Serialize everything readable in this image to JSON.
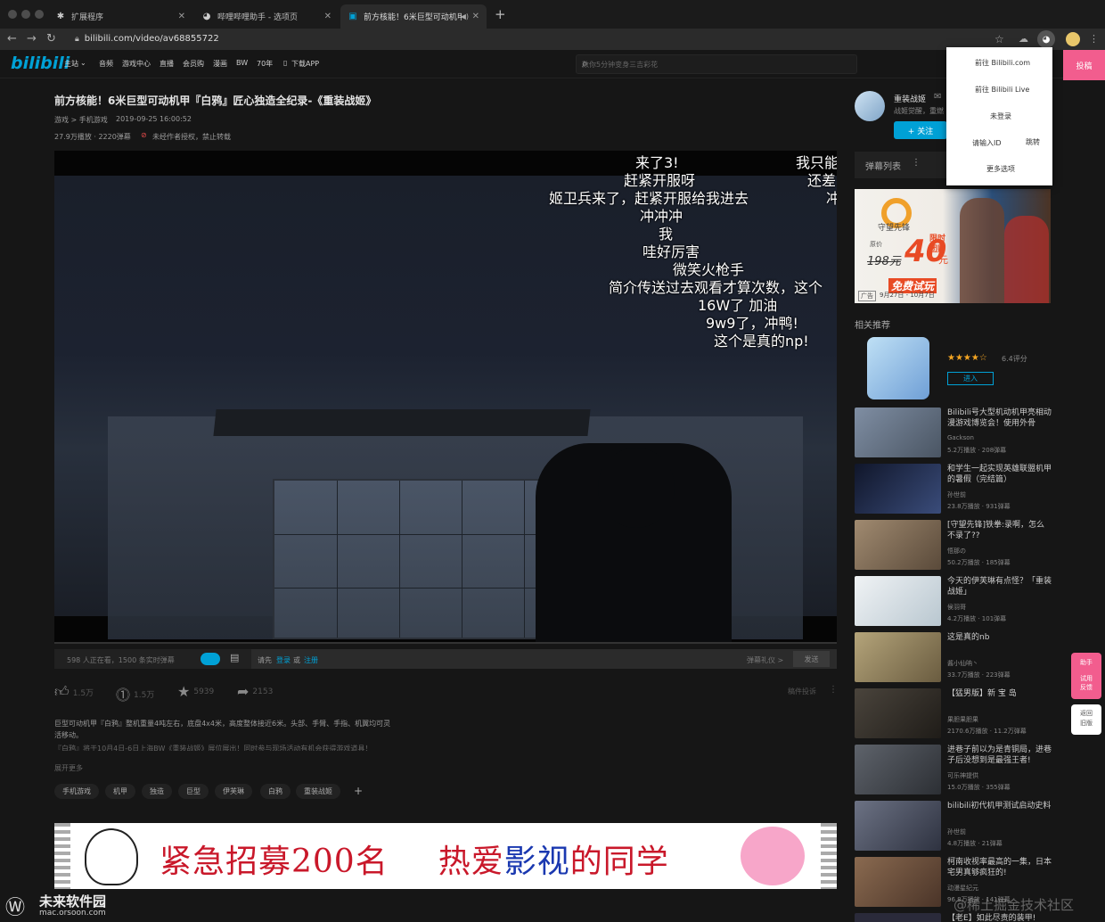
{
  "browser": {
    "tabs": [
      {
        "label": "扩展程序",
        "icon": "puzzle-icon",
        "active": false
      },
      {
        "label": "哔哩哔哩助手 - 选项页",
        "icon": "bilibili-helper-icon",
        "active": false
      },
      {
        "label": "前方核能！6米巨型可动机甲",
        "icon": "bilibili-tv-icon",
        "active": true
      }
    ],
    "new_tab": "+",
    "url": "bilibili.com/video/av68855722"
  },
  "nav": {
    "logo": "bilibili",
    "items": [
      "主站",
      "音频",
      "游戏中心",
      "直播",
      "会员购",
      "漫画",
      "BW",
      "70年",
      "下载APP"
    ],
    "search_placeholder": "数你5分钟变身三吉彩花",
    "upload": "投稿"
  },
  "ext_popup": {
    "items": [
      "前往 Bilibili.com",
      "前往 Bilibili Live",
      "未登录",
      "请输入ID",
      "跳转",
      "更多选项"
    ]
  },
  "video": {
    "title": "前方核能！6米巨型可动机甲『白鸦』匠心独造全纪录-《重装战姬》",
    "category": "游戏 > 手机游戏",
    "date": "2019-09-25 16:00:52",
    "stats": "27.9万播放 · 2220弹幕",
    "notice": "未经作者授权，禁止转载",
    "danmaku": [
      "来了3!",
      "我只能",
      "赶紧开服呀",
      "还差",
      "姬卫兵来了，赶紧开服给我进去",
      "冲",
      "冲冲冲",
      "我",
      "哇好厉害",
      "微笑火枪手",
      "简介传送过去观看才算次数，这个",
      "16W了  加油",
      "9w9了，冲鸭!",
      "这个是真的np!"
    ]
  },
  "controls": {
    "viewers": "598 人正在看，1500 条实时弹幕",
    "login_prompt": "请先",
    "login": "登录",
    "or": "或",
    "register": "注册",
    "etiquette": "弹幕礼仪 >",
    "send": "发送"
  },
  "actions": {
    "like": "1.5万",
    "coin": "1.5万",
    "fav": "5939",
    "share": "2153",
    "report": "稿件投诉"
  },
  "description": {
    "line1": "巨型可动机甲『白鸦』整机重量4吨左右，底盘4x4米，高度整体接近6米。头部、手臂、手指、机翼均可灵",
    "line2": "活移动。",
    "line3": "『白鸦』将于10月4日-6日上海BW《重装战姬》展位展出！同时参与现场活动有机会获得游戏道具！",
    "expand": "展开更多"
  },
  "tags": [
    "手机游戏",
    "机甲",
    "独造",
    "巨型",
    "伊芙琳",
    "白鸦",
    "重装战姬",
    "+"
  ],
  "banner": {
    "part1": "紧急招募200名",
    "part2": "热爱",
    "part3": "影视",
    "part4": "的同学"
  },
  "uploader": {
    "name": "重装战姬",
    "sign": "战姬觉醒，重燃",
    "follow": "+ 关注"
  },
  "danmaku_list": {
    "label": "弹幕列表",
    "more": "⋮"
  },
  "ad": {
    "brand": "守望先锋",
    "price_prefix": "原价",
    "orig_price": "198元",
    "price": "40",
    "unit": "元",
    "tag": "限时团购",
    "trial": "免费试玩",
    "ad_label": "广告",
    "date": "9月27日 - 10月7日"
  },
  "recommend": {
    "title": "相关推荐",
    "game_rating": "6.4评分",
    "game_enter": "进入",
    "items": [
      {
        "title": "Bilibili号大型机动机甲亮相动漫游戏博览会！使用外骨",
        "author": "Gackson",
        "stats": "5.2万播放 · 208弹幕",
        "color": "#6a7a8c"
      },
      {
        "title": "和学生一起实现英雄联盟机甲的暑假（完结篇）",
        "author": "孙世前",
        "stats": "23.8万播放 · 931弹幕",
        "color": "#1c2238"
      },
      {
        "title": "[守望先锋]铁拳:录啊，怎么不录了??",
        "author": "悟那の",
        "stats": "50.2万播放 · 185弹幕",
        "color": "#8c7a6a"
      },
      {
        "title": "今天的伊芙琳有点怪？「重装战姬」",
        "author": "侯羽哥",
        "stats": "4.2万播放 · 101弹幕",
        "color": "#d8dde0"
      },
      {
        "title": "这是真的nb",
        "author": "酱小仙呐丶",
        "stats": "33.7万播放 · 223弹幕",
        "color": "#9a8c6a"
      },
      {
        "title": "【猛男版】新 宝 岛",
        "author": "果胆果胆果",
        "stats": "2170.6万播放 · 11.2万弹幕",
        "color": "#3a3530"
      },
      {
        "title": "进巷子前以为是青铜局，进巷子后没想到是最强王者!",
        "author": "可乐神提供",
        "stats": "15.0万播放 · 355弹幕",
        "color": "#4a4d52"
      },
      {
        "title": "bilibili初代机甲测试启动史料",
        "author": "孙世前",
        "stats": "4.8万播放 · 21弹幕",
        "color": "#5a6070"
      },
      {
        "title": "柯南收视率最高的一集，日本宅男真够疯狂的!",
        "author": "动漫星纪元",
        "stats": "96.8万播放 · 141弹幕",
        "color": "#6a5040"
      },
      {
        "title": "【老E】如此尽责的装甲!",
        "author": "",
        "stats": "",
        "color": "#2a2a3a"
      }
    ]
  },
  "side": {
    "helper": "助手",
    "trial": "试用\n反馈",
    "back": "返回\n旧版"
  },
  "watermark": {
    "site": "未来软件园",
    "domain": "mac.orsoon.com",
    "community": "@稀土掘金技术社区"
  },
  "colors": {
    "accent_pink": "#f25d8e",
    "accent_blue": "#00a1d6",
    "bg": "#161616"
  }
}
